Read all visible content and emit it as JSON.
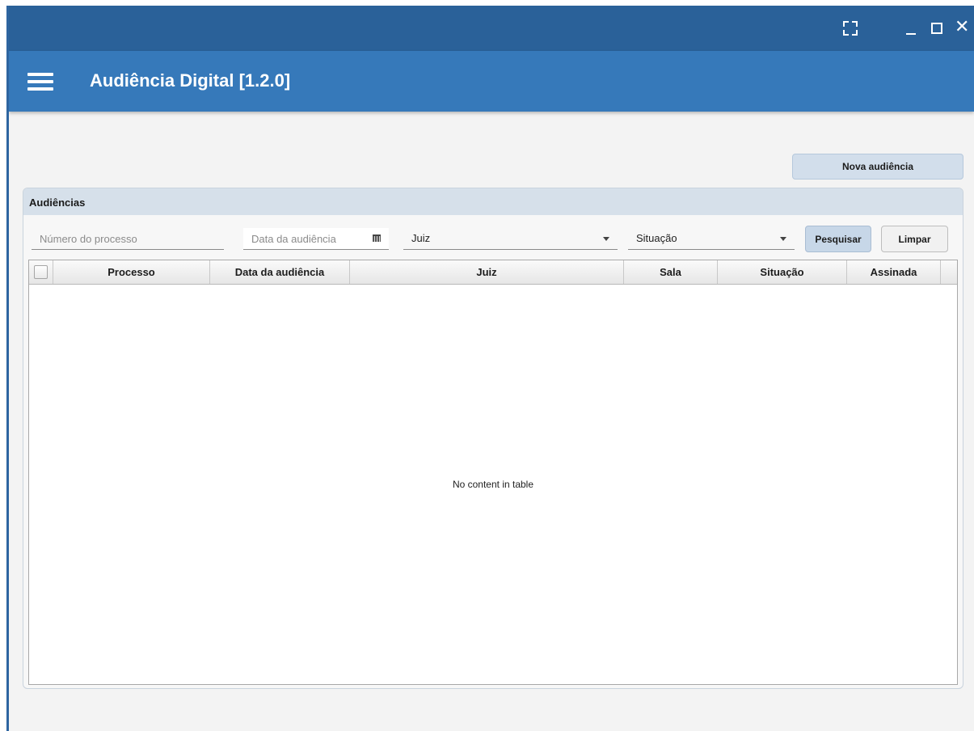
{
  "window": {
    "fullscreen_icon": "fullscreen-icon",
    "minimize_icon": "minimize-icon",
    "maximize_icon": "maximize-icon",
    "close_icon": "close-icon",
    "close_glyph": "✕"
  },
  "appbar": {
    "title": "Audiência Digital [1.2.0]",
    "menu_icon": "hamburger-menu-icon"
  },
  "actions": {
    "new_label": "Nova audiência"
  },
  "panel": {
    "title": "Audiências",
    "filters": {
      "processo_placeholder": "Número do processo",
      "data_placeholder": "Data da audiência",
      "juiz_label": "Juiz",
      "situacao_label": "Situação",
      "search_label": "Pesquisar",
      "clear_label": "Limpar"
    },
    "table": {
      "columns": [
        "Processo",
        "Data da audiência",
        "Juiz",
        "Sala",
        "Situação",
        "Assinada"
      ],
      "rows": [],
      "empty_text": "No content in table"
    }
  },
  "colors": {
    "titlebar": "#2a6199",
    "appbar": "#3679ba",
    "panel_header": "#d6e0ea"
  }
}
